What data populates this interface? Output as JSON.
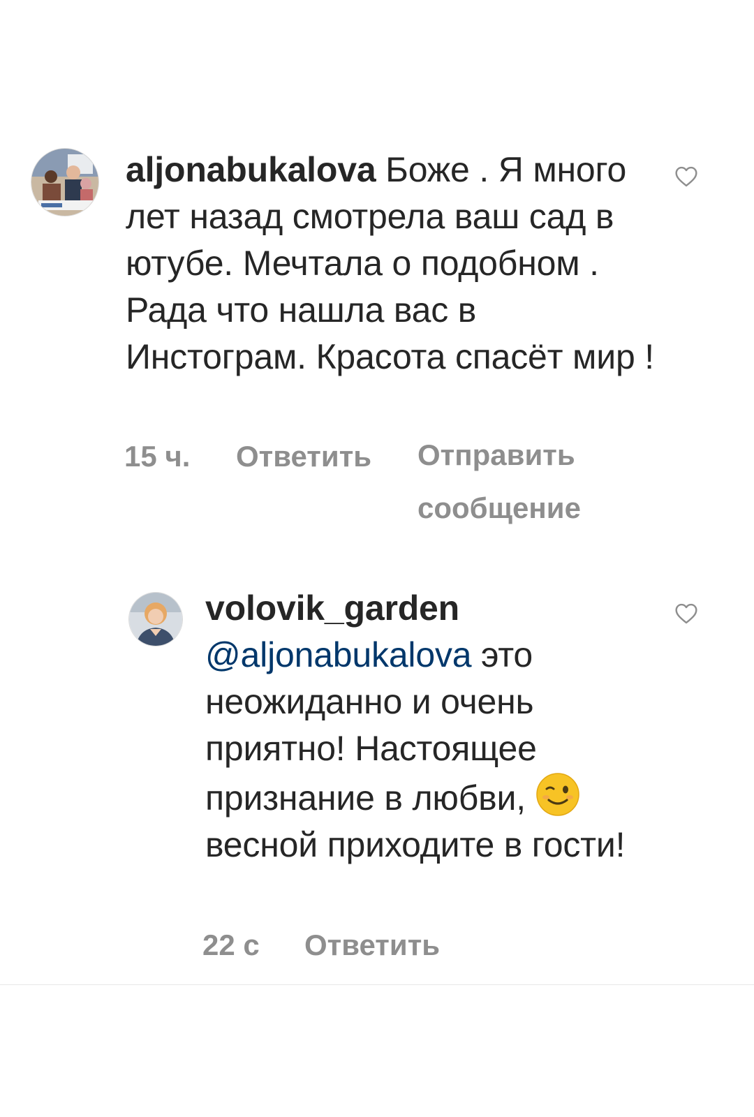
{
  "comments": [
    {
      "username": "aljonabukalova",
      "text": "Боже . Я много лет назад смотрела ваш сад в ютубе. Мечтала о подобном . Рада что  нашла вас в Инстограм. Красота спасёт мир !",
      "time": "15 ч.",
      "reply_label": "Ответить",
      "send_message_label": "Отправить сообщение",
      "avatar_icon": "profile-photo",
      "like_icon": "heart-outline-icon"
    },
    {
      "username": "volovik_garden",
      "mention": "@aljonabukalova",
      "text_part1": " это неожиданно и очень приятно! Настоящее признание в любви, ",
      "emoji": "winking-face",
      "text_part2": "весной приходите в гости!",
      "time": "22 с",
      "reply_label": "Ответить",
      "avatar_icon": "profile-photo",
      "like_icon": "heart-outline-icon"
    }
  ],
  "colors": {
    "text": "#262626",
    "meta": "#8e8e8e",
    "mention": "#00376b",
    "divider": "#e8e8e8"
  }
}
